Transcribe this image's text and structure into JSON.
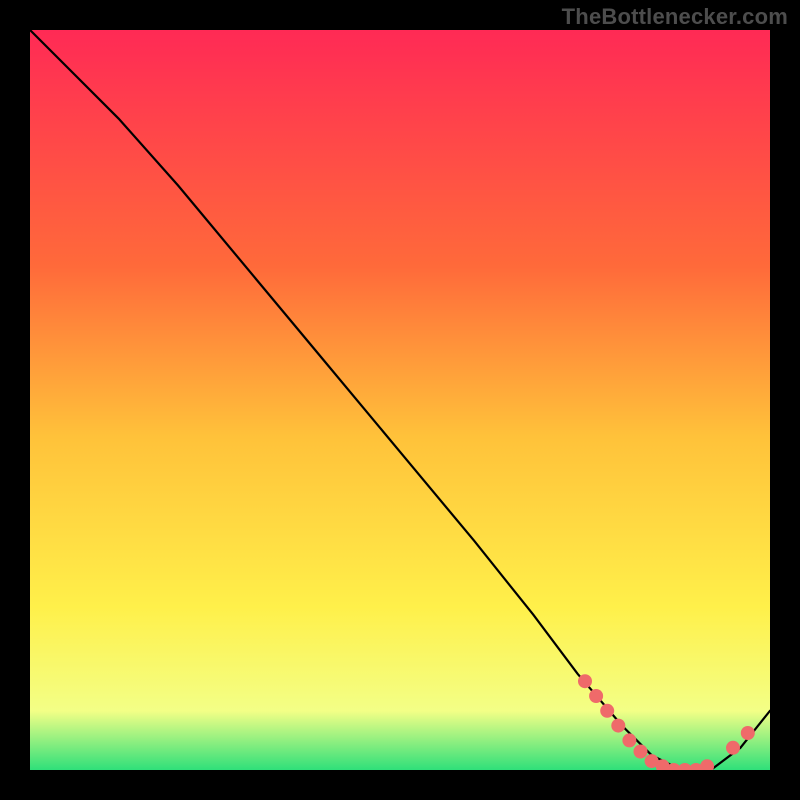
{
  "watermark": "TheBottlenecker.com",
  "colors": {
    "grad_top": "#ff2a55",
    "grad_mid1": "#ff6a3a",
    "grad_mid2": "#ffc23a",
    "grad_mid3": "#fff04a",
    "grad_low": "#f3ff86",
    "grad_green": "#2fe07a",
    "curve": "#000000",
    "marker": "#ef6a6a"
  },
  "chart_data": {
    "type": "line",
    "title": "",
    "xlabel": "",
    "ylabel": "",
    "xlim": [
      0,
      100
    ],
    "ylim": [
      0,
      100
    ],
    "series": [
      {
        "name": "bottleneck-curve",
        "x": [
          0,
          6,
          12,
          20,
          30,
          40,
          50,
          60,
          68,
          74,
          80,
          84,
          88,
          92,
          96,
          100
        ],
        "y": [
          100,
          94,
          88,
          79,
          67,
          55,
          43,
          31,
          21,
          13,
          6,
          2,
          0,
          0,
          3,
          8
        ]
      }
    ],
    "markers": [
      {
        "x": 75,
        "y": 12
      },
      {
        "x": 76.5,
        "y": 10
      },
      {
        "x": 78,
        "y": 8
      },
      {
        "x": 79.5,
        "y": 6
      },
      {
        "x": 81,
        "y": 4
      },
      {
        "x": 82.5,
        "y": 2.5
      },
      {
        "x": 84,
        "y": 1.2
      },
      {
        "x": 85.5,
        "y": 0.5
      },
      {
        "x": 87,
        "y": 0
      },
      {
        "x": 88.5,
        "y": 0
      },
      {
        "x": 90,
        "y": 0
      },
      {
        "x": 91.5,
        "y": 0.5
      },
      {
        "x": 95,
        "y": 3
      },
      {
        "x": 97,
        "y": 5
      }
    ]
  }
}
